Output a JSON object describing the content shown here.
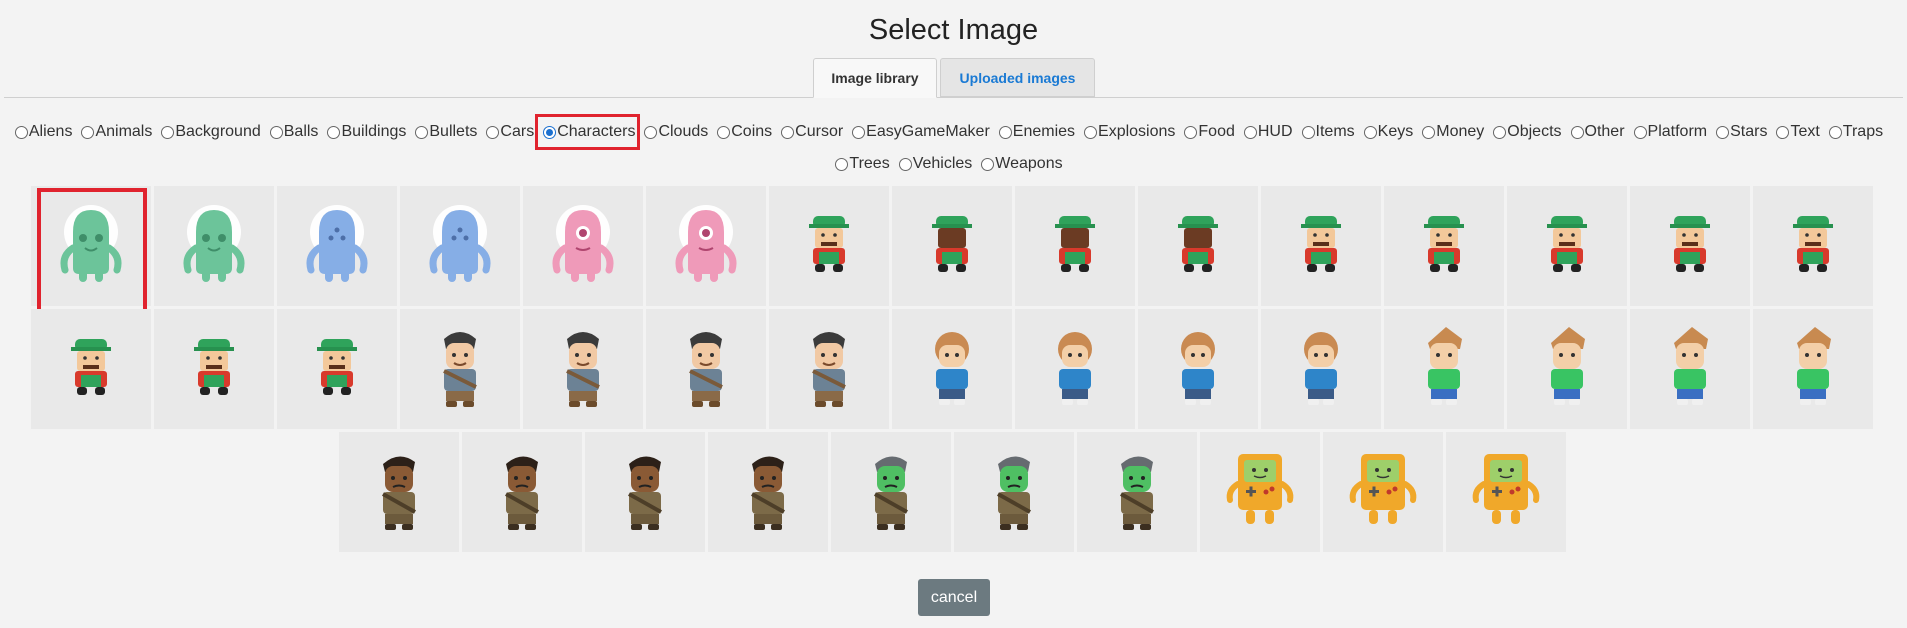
{
  "title": "Select Image",
  "tabs": [
    {
      "label": "Image library",
      "active": true
    },
    {
      "label": "Uploaded images",
      "active": false
    }
  ],
  "categories_row1": [
    "Aliens",
    "Animals",
    "Background",
    "Balls",
    "Buildings",
    "Bullets",
    "Cars",
    "Characters",
    "Clouds",
    "Coins",
    "Cursor",
    "EasyGameMaker",
    "Enemies",
    "Explosions",
    "Food",
    "HUD",
    "Items",
    "Keys",
    "Money",
    "Objects",
    "Other",
    "Platform",
    "Stars",
    "Text",
    "Traps"
  ],
  "categories_row2": [
    "Trees",
    "Vehicles",
    "Weapons"
  ],
  "selected_category": "Characters",
  "thumbnails": {
    "row1": [
      "alien-green",
      "alien-green",
      "alien-blue",
      "alien-blue",
      "alien-pink",
      "alien-pink",
      "plumber",
      "plumber-back",
      "plumber-back",
      "plumber-back",
      "plumber-side",
      "plumber-side",
      "plumber-side",
      "plumber-side",
      "plumber-side"
    ],
    "row2": [
      "plumber-side",
      "plumber",
      "plumber",
      "adventurer",
      "adventurer",
      "adventurer",
      "adventurer",
      "girl-blue",
      "girl-blue",
      "girl-blue",
      "girl-blue",
      "boy-green",
      "boy-green",
      "boy-green",
      "boy-green"
    ],
    "row3": [
      "brawler-dark",
      "brawler-dark",
      "brawler-dark",
      "brawler-dark",
      "zombie-green",
      "zombie-green",
      "zombie-green",
      "handheld-console",
      "handheld-console",
      "handheld-console"
    ]
  },
  "selected_thumbnail": 0,
  "colors": {
    "accent": "#e0232e",
    "link": "#1a7ad4",
    "button": "#6c7a80"
  },
  "cancel_label": "cancel"
}
